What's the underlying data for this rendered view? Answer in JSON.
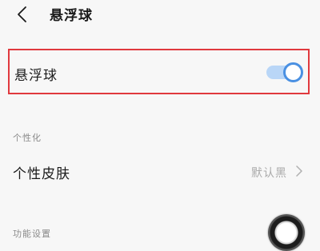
{
  "header": {
    "back_icon": "chevron-left-icon",
    "title": "悬浮球"
  },
  "floating_ball_setting": {
    "label": "悬浮球",
    "toggle_on": true,
    "accent_color": "#4a90e2",
    "highlight_border_color": "#e0393e"
  },
  "sections": {
    "personalization": {
      "title": "个性化",
      "items": [
        {
          "label": "个性皮肤",
          "value": "默认黑",
          "icon": "chevron-right-icon"
        }
      ]
    },
    "function_settings": {
      "title": "功能设置"
    }
  },
  "floating_ball": {
    "icon": "floating-ball-icon"
  }
}
